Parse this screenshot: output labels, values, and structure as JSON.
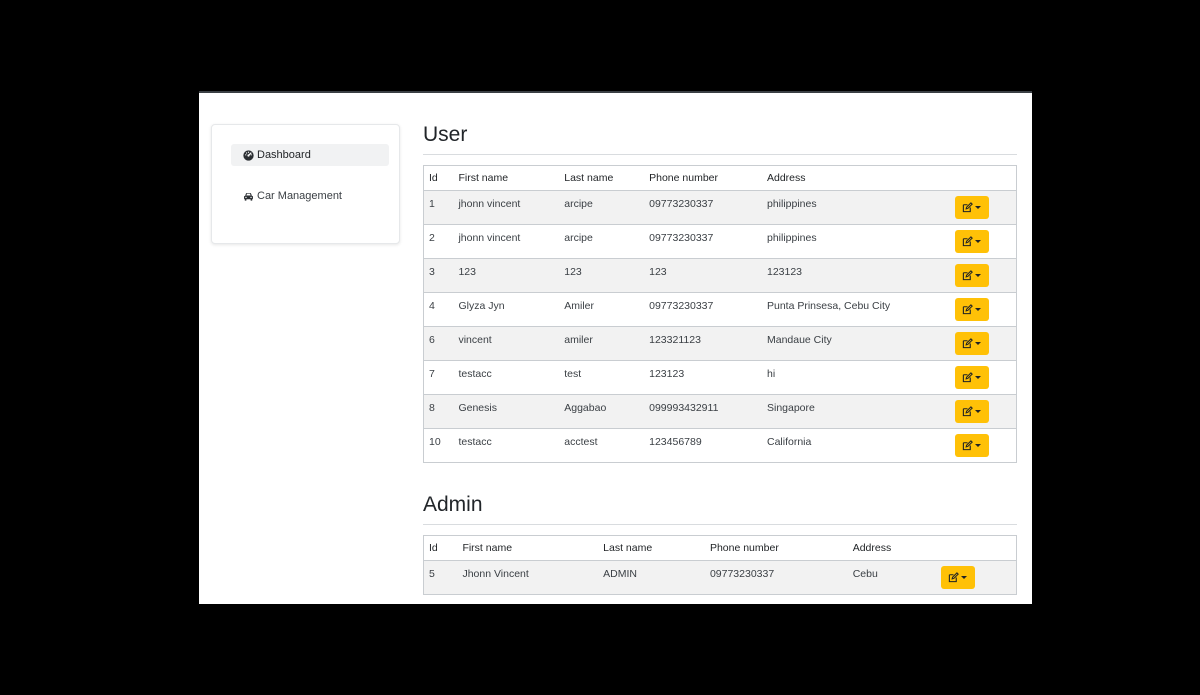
{
  "sidebar": {
    "items": [
      {
        "label": "Dashboard",
        "icon": "dashboard-icon",
        "active": true
      },
      {
        "label": "Car Management",
        "icon": "car-icon",
        "active": false
      }
    ]
  },
  "user_section": {
    "title": "User",
    "columns": [
      "Id",
      "First name",
      "Last name",
      "Phone number",
      "Address"
    ],
    "rows": [
      {
        "id": "1",
        "first": "jhonn vincent",
        "last": "arcipe",
        "phone": "09773230337",
        "address": "philippines"
      },
      {
        "id": "2",
        "first": "jhonn vincent",
        "last": "arcipe",
        "phone": "09773230337",
        "address": "philippines"
      },
      {
        "id": "3",
        "first": "123",
        "last": "123",
        "phone": "123",
        "address": "123123"
      },
      {
        "id": "4",
        "first": "Glyza Jyn",
        "last": "Amiler",
        "phone": "09773230337",
        "address": "Punta Prinsesa, Cebu City"
      },
      {
        "id": "6",
        "first": "vincent",
        "last": "amiler",
        "phone": "123321123",
        "address": "Mandaue City"
      },
      {
        "id": "7",
        "first": "testacc",
        "last": "test",
        "phone": "123123",
        "address": "hi"
      },
      {
        "id": "8",
        "first": "Genesis",
        "last": "Aggabao",
        "phone": "099993432911",
        "address": "Singapore"
      },
      {
        "id": "10",
        "first": "testacc",
        "last": "acctest",
        "phone": "123456789",
        "address": "California"
      }
    ]
  },
  "admin_section": {
    "title": "Admin",
    "columns": [
      "Id",
      "First name",
      "Last name",
      "Phone number",
      "Address"
    ],
    "rows": [
      {
        "id": "5",
        "first": "Jhonn Vincent",
        "last": "ADMIN",
        "phone": "09773230337",
        "address": "Cebu"
      }
    ]
  },
  "colors": {
    "action_button": "#ffc107",
    "row_stripe": "#f2f2f2",
    "border": "#c9cdd1"
  },
  "action_icon": "edit-icon"
}
